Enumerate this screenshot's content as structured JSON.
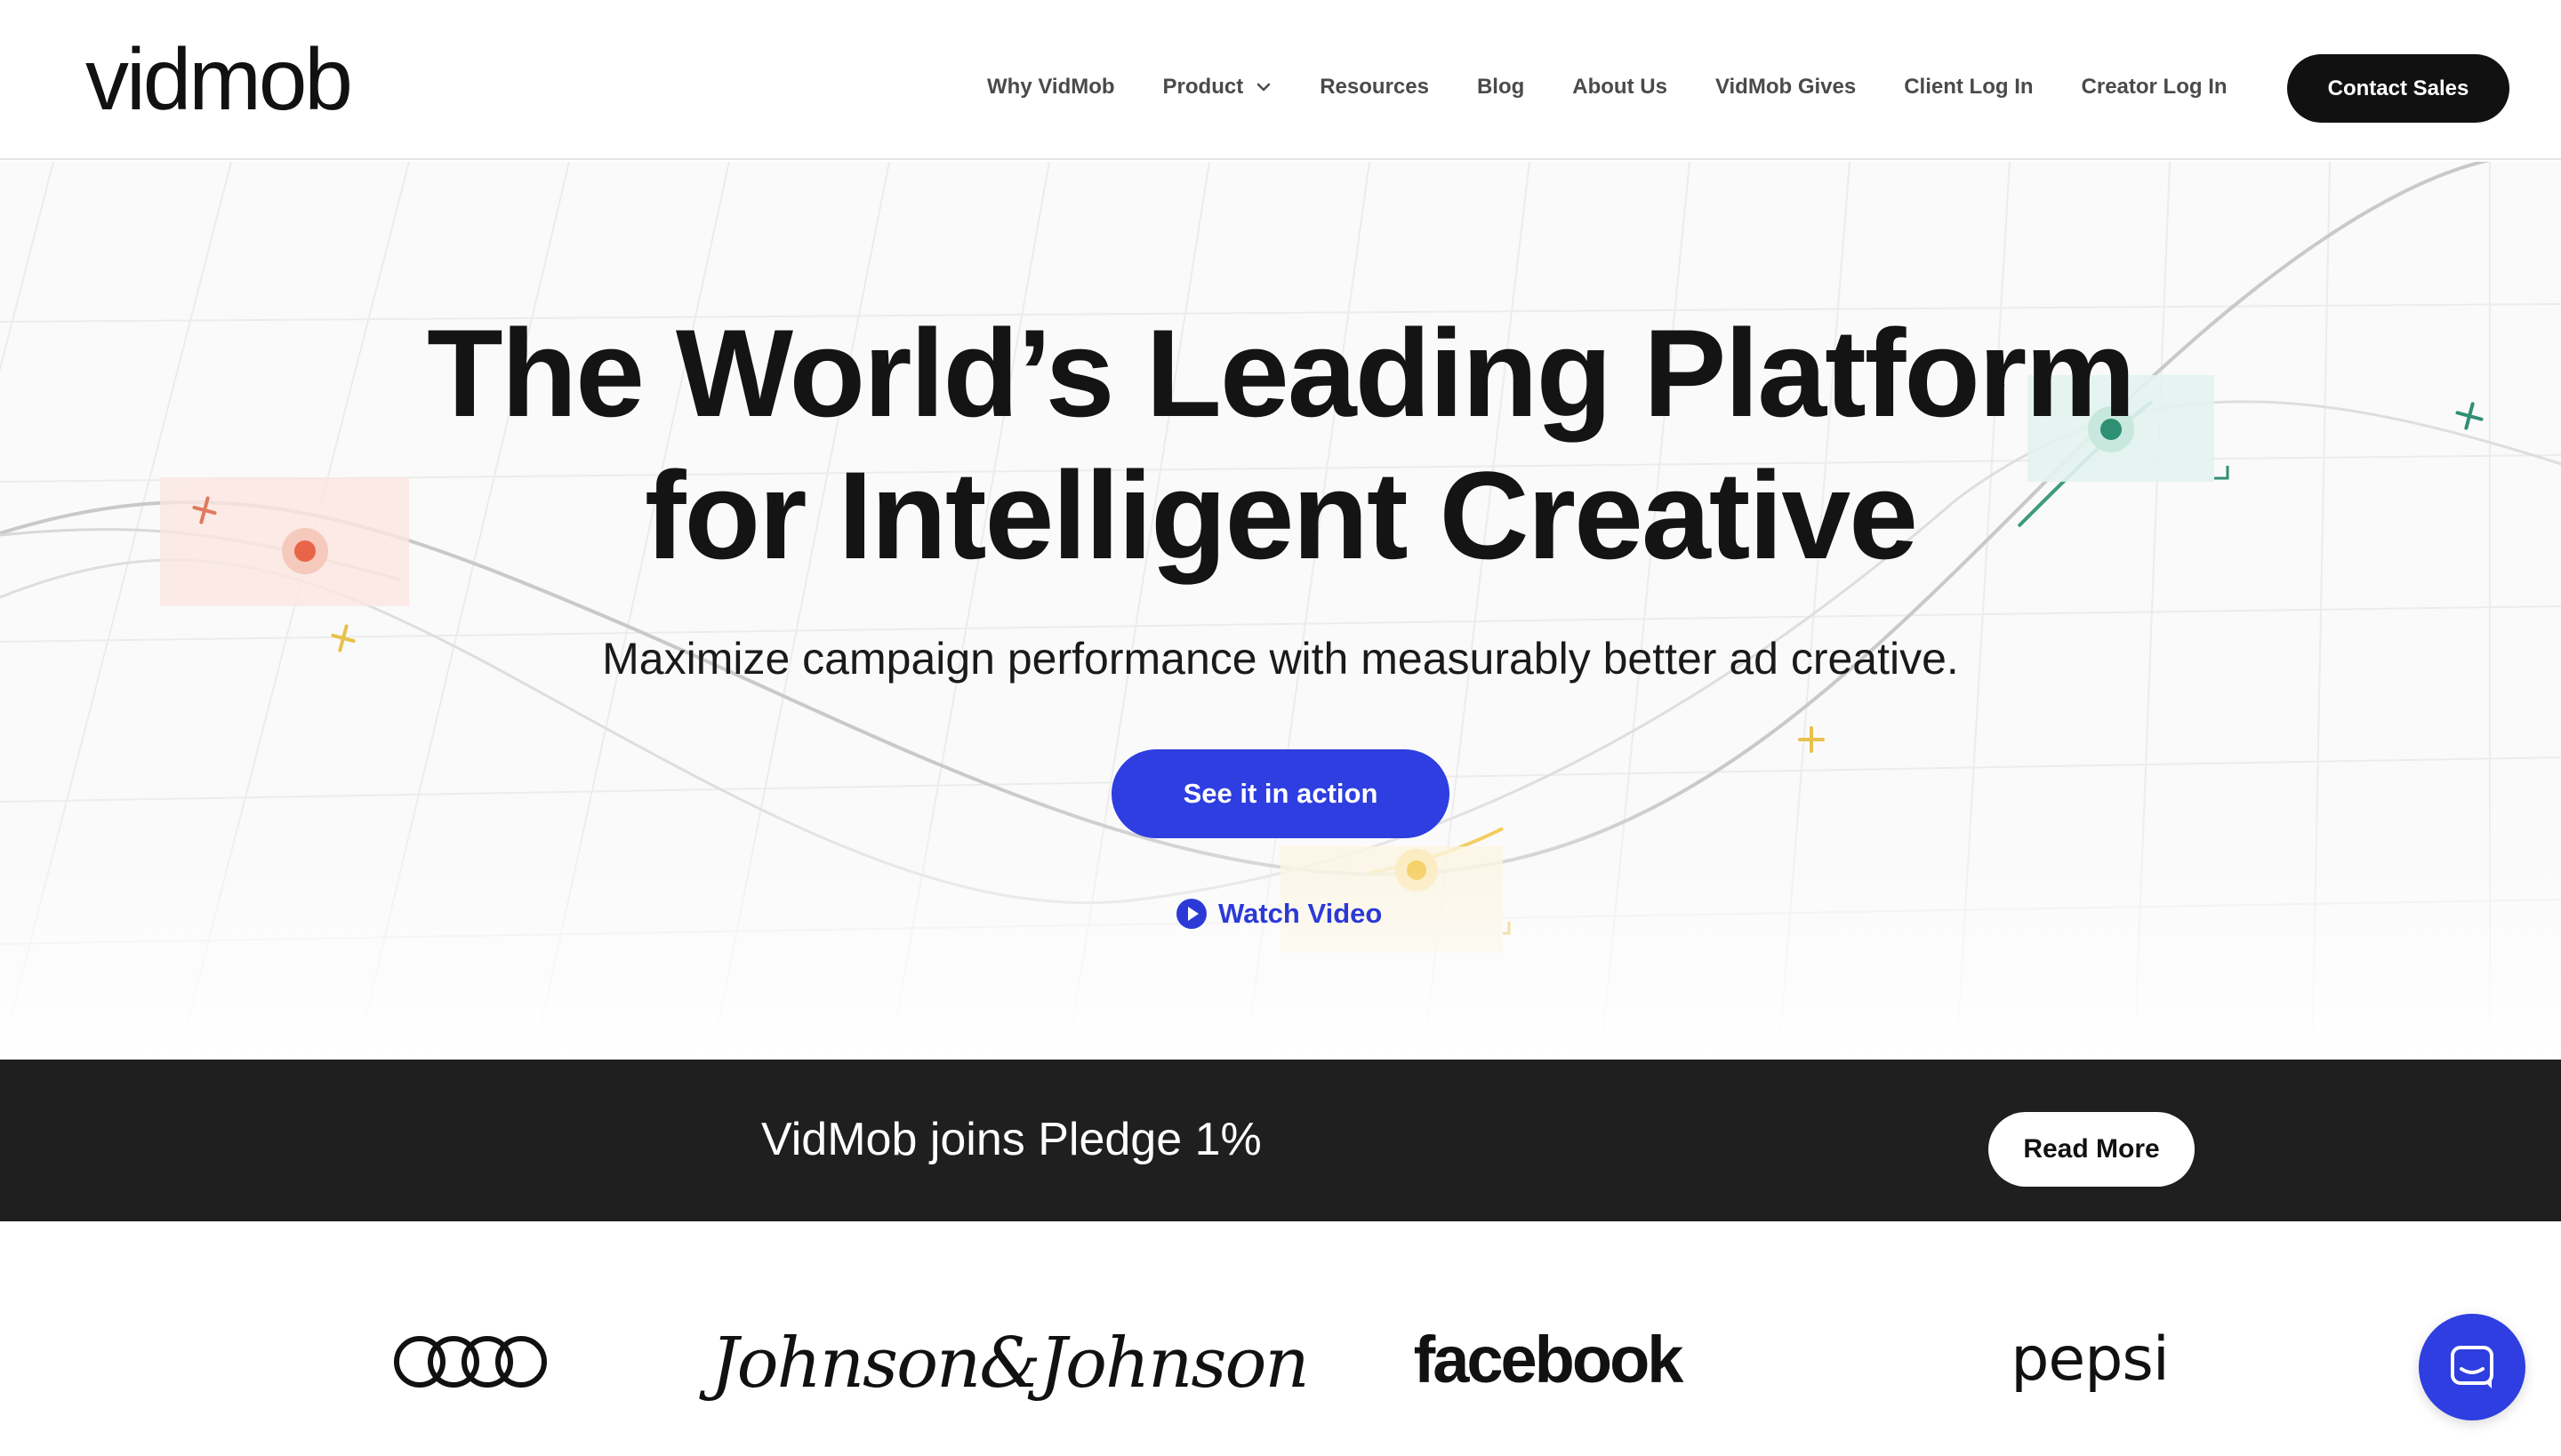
{
  "header": {
    "logo_text": "vidmob",
    "nav": [
      {
        "label": "Why VidMob"
      },
      {
        "label": "Product",
        "has_dropdown": true
      },
      {
        "label": "Resources"
      },
      {
        "label": "Blog"
      },
      {
        "label": "About Us"
      },
      {
        "label": "VidMob Gives"
      },
      {
        "label": "Client Log In"
      },
      {
        "label": "Creator Log In"
      }
    ],
    "contact_label": "Contact Sales"
  },
  "hero": {
    "headline_line1": "The World’s Leading Platform",
    "headline_line2": "for Intelligent Creative",
    "subheadline": "Maximize campaign performance with measurably better ad creative.",
    "cta_label": "See it in action",
    "watch_label": "Watch Video"
  },
  "banner": {
    "text": "VidMob joins Pledge 1%",
    "button_label": "Read More"
  },
  "client_logos": [
    {
      "name": "audi",
      "icon": "audi-rings-logo"
    },
    {
      "name": "johnson-and-johnson",
      "text": "Johnson&Johnson"
    },
    {
      "name": "facebook",
      "text": "facebook"
    },
    {
      "name": "pepsi",
      "text": "pepsi"
    }
  ],
  "colors": {
    "accent_blue": "#2e3ee0",
    "banner_bg": "#1f1f1f",
    "dot_red": "#e8654a",
    "dot_green": "#2f8f72",
    "dot_yellow": "#f2c02e"
  },
  "chat_icon": "chat-bubble-icon"
}
